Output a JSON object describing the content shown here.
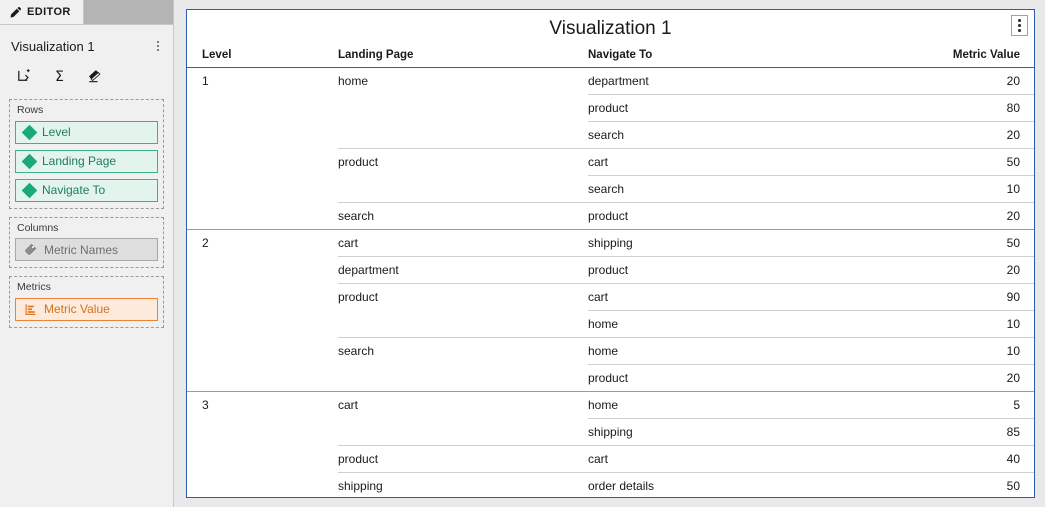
{
  "sidebar": {
    "tab": {
      "label": "EDITOR",
      "icon": "pencil-icon",
      "active": true
    },
    "visualization_name": "Visualization 1",
    "name_menu_icon": "kebab-menu-icon",
    "toolbar": [
      {
        "name": "insert-subtotal-icon",
        "title": "Insert"
      },
      {
        "name": "sigma-total-icon",
        "title": "Totals"
      },
      {
        "name": "eraser-clear-icon",
        "title": "Clear"
      }
    ],
    "zones": [
      {
        "title": "Rows",
        "items": [
          {
            "label": "Level",
            "kind": "attribute",
            "icon": "diamond-attribute-icon"
          },
          {
            "label": "Landing Page",
            "kind": "attribute",
            "icon": "diamond-attribute-icon"
          },
          {
            "label": "Navigate To",
            "kind": "attribute",
            "icon": "diamond-attribute-icon"
          }
        ]
      },
      {
        "title": "Columns",
        "items": [
          {
            "label": "Metric Names",
            "kind": "neutral",
            "icon": "tag-metric-names-icon"
          }
        ]
      },
      {
        "title": "Metrics",
        "items": [
          {
            "label": "Metric Value",
            "kind": "metric",
            "icon": "bar-chart-metric-icon"
          }
        ]
      }
    ]
  },
  "visualization": {
    "title": "Visualization 1",
    "menu_icon": "kebab-menu-icon",
    "border_color": "#2a5db0",
    "columns": [
      "Level",
      "Landing Page",
      "Navigate To",
      "Metric Value"
    ],
    "rows": [
      {
        "level": "1",
        "landing_page": "home",
        "navigate_to": "department",
        "metric_value": "20",
        "sep": "level"
      },
      {
        "level": "",
        "landing_page": "",
        "navigate_to": "product",
        "metric_value": "80",
        "sep": "nav"
      },
      {
        "level": "",
        "landing_page": "",
        "navigate_to": "search",
        "metric_value": "20",
        "sep": "nav"
      },
      {
        "level": "",
        "landing_page": "product",
        "navigate_to": "cart",
        "metric_value": "50",
        "sep": "land"
      },
      {
        "level": "",
        "landing_page": "",
        "navigate_to": "search",
        "metric_value": "10",
        "sep": "nav"
      },
      {
        "level": "",
        "landing_page": "search",
        "navigate_to": "product",
        "metric_value": "20",
        "sep": "land"
      },
      {
        "level": "2",
        "landing_page": "cart",
        "navigate_to": "shipping",
        "metric_value": "50",
        "sep": "level"
      },
      {
        "level": "",
        "landing_page": "department",
        "navigate_to": "product",
        "metric_value": "20",
        "sep": "land"
      },
      {
        "level": "",
        "landing_page": "product",
        "navigate_to": "cart",
        "metric_value": "90",
        "sep": "land"
      },
      {
        "level": "",
        "landing_page": "",
        "navigate_to": "home",
        "metric_value": "10",
        "sep": "nav"
      },
      {
        "level": "",
        "landing_page": "search",
        "navigate_to": "home",
        "metric_value": "10",
        "sep": "land"
      },
      {
        "level": "",
        "landing_page": "",
        "navigate_to": "product",
        "metric_value": "20",
        "sep": "nav"
      },
      {
        "level": "3",
        "landing_page": "cart",
        "navigate_to": "home",
        "metric_value": "5",
        "sep": "level"
      },
      {
        "level": "",
        "landing_page": "",
        "navigate_to": "shipping",
        "metric_value": "85",
        "sep": "nav"
      },
      {
        "level": "",
        "landing_page": "product",
        "navigate_to": "cart",
        "metric_value": "40",
        "sep": "land"
      },
      {
        "level": "",
        "landing_page": "shipping",
        "navigate_to": "order details",
        "metric_value": "50",
        "sep": "land"
      }
    ]
  }
}
